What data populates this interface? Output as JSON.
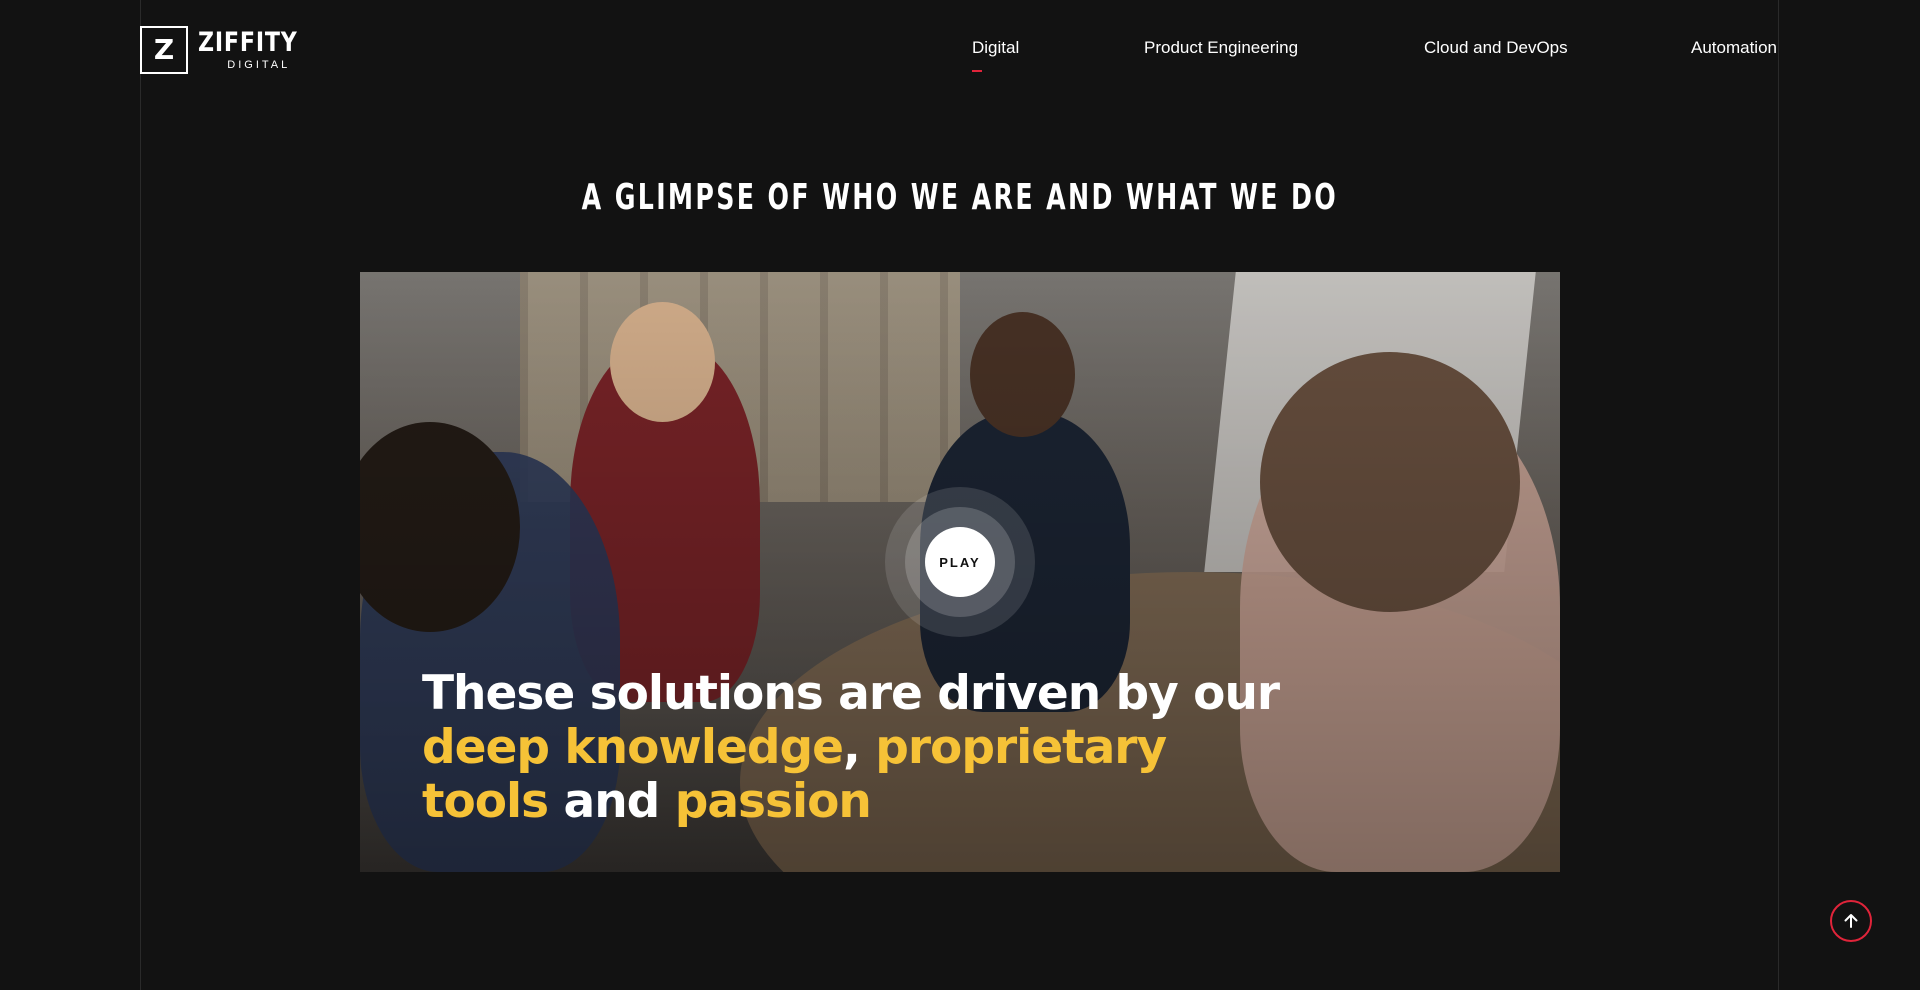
{
  "brand": {
    "logo_mark": "Z",
    "name": "ZIFFITY",
    "sub": "DIGITAL"
  },
  "nav": {
    "items": [
      {
        "label": "Digital",
        "active": true
      },
      {
        "label": "Product Engineering",
        "active": false
      },
      {
        "label": "Cloud and DevOps",
        "active": false
      },
      {
        "label": "Automation",
        "active": false
      }
    ]
  },
  "section": {
    "heading": "A GLIMPSE OF WHO WE ARE AND WHAT WE DO"
  },
  "video": {
    "caption_line1": "These solutions are driven by our",
    "caption_line2_a": "deep knowledge",
    "caption_line2_b": ", ",
    "caption_line2_c": "proprietary",
    "caption_line3_a": "tools",
    "caption_line3_b": " and ",
    "caption_line3_c": "passion",
    "play_label": "PLAY"
  },
  "colors": {
    "background": "#121212",
    "accent": "#e0243a",
    "highlight": "#f6c237"
  },
  "icons": {
    "scroll_top": "arrow-up-icon"
  }
}
